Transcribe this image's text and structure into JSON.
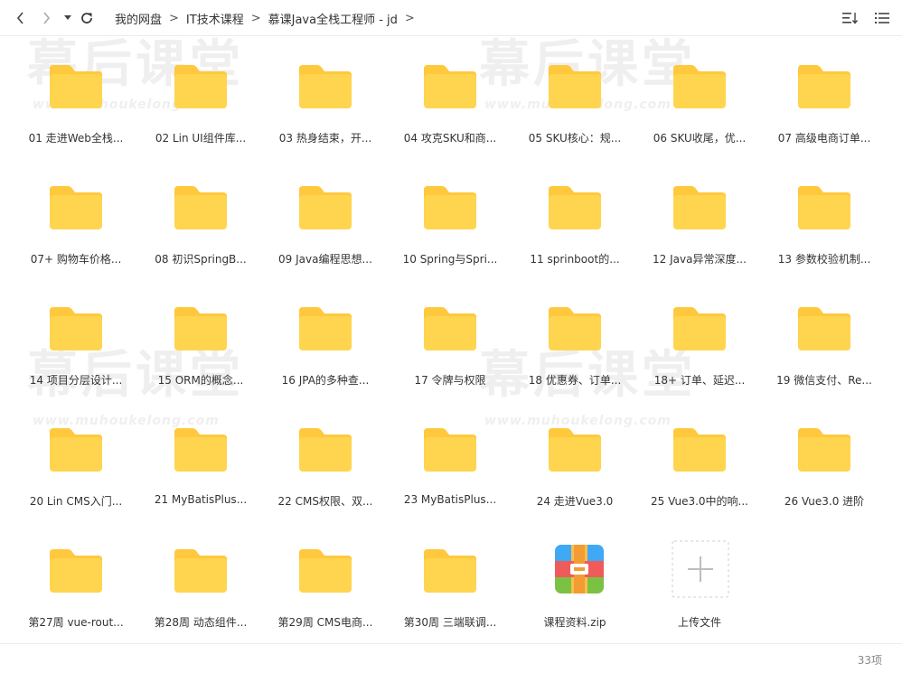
{
  "nav": {
    "back_icon": "chevron-left-icon",
    "forward_icon": "chevron-right-icon",
    "history_icon": "caret-down-icon",
    "refresh_icon": "refresh-icon"
  },
  "breadcrumb": {
    "items": [
      "我的网盘",
      "IT技术课程",
      "慕课Java全栈工程师 - jd"
    ],
    "separator": ">"
  },
  "view": {
    "sort_icon": "sort-icon",
    "list_icon": "list-view-icon"
  },
  "watermark": {
    "big": "幕后课堂",
    "small": "www.muhoukelong.com"
  },
  "colors": {
    "folder": "#FFD54F",
    "folder_tab": "#FFC83D",
    "accent": "#f5a623"
  },
  "files": [
    {
      "name": "01 走进Web全栈...",
      "type": "folder"
    },
    {
      "name": "02 Lin UI组件库...",
      "type": "folder"
    },
    {
      "name": "03 热身结束，开...",
      "type": "folder"
    },
    {
      "name": "04 攻克SKU和商...",
      "type": "folder"
    },
    {
      "name": "05 SKU核心：规...",
      "type": "folder"
    },
    {
      "name": "06 SKU收尾，优...",
      "type": "folder"
    },
    {
      "name": "07 高级电商订单...",
      "type": "folder"
    },
    {
      "name": "07+ 购物车价格...",
      "type": "folder"
    },
    {
      "name": "08 初识SpringB...",
      "type": "folder"
    },
    {
      "name": "09 Java编程思想...",
      "type": "folder"
    },
    {
      "name": "10 Spring与Spri...",
      "type": "folder"
    },
    {
      "name": "11 sprinboot的...",
      "type": "folder"
    },
    {
      "name": "12 Java异常深度...",
      "type": "folder"
    },
    {
      "name": "13 参数校验机制...",
      "type": "folder"
    },
    {
      "name": "14 项目分层设计...",
      "type": "folder"
    },
    {
      "name": "15 ORM的概念...",
      "type": "folder"
    },
    {
      "name": "16 JPA的多种查...",
      "type": "folder"
    },
    {
      "name": "17 令牌与权限",
      "type": "folder"
    },
    {
      "name": "18 优惠券、订单...",
      "type": "folder"
    },
    {
      "name": "18+ 订单、延迟...",
      "type": "folder"
    },
    {
      "name": "19 微信支付、Re...",
      "type": "folder"
    },
    {
      "name": "20 Lin CMS入门...",
      "type": "folder"
    },
    {
      "name": "21 MyBatisPlus...",
      "type": "folder"
    },
    {
      "name": "22 CMS权限、双...",
      "type": "folder"
    },
    {
      "name": "23 MyBatisPlus...",
      "type": "folder"
    },
    {
      "name": "24 走进Vue3.0",
      "type": "folder"
    },
    {
      "name": "25 Vue3.0中的响...",
      "type": "folder"
    },
    {
      "name": "26 Vue3.0 进阶",
      "type": "folder"
    },
    {
      "name": "第27周 vue-rout...",
      "type": "folder"
    },
    {
      "name": "第28周 动态组件...",
      "type": "folder"
    },
    {
      "name": "第29周 CMS电商...",
      "type": "folder"
    },
    {
      "name": "第30周 三端联调...",
      "type": "folder"
    },
    {
      "name": "课程资料.zip",
      "type": "zip"
    },
    {
      "name": "上传文件",
      "type": "upload"
    }
  ],
  "footer": {
    "count": "33项"
  }
}
